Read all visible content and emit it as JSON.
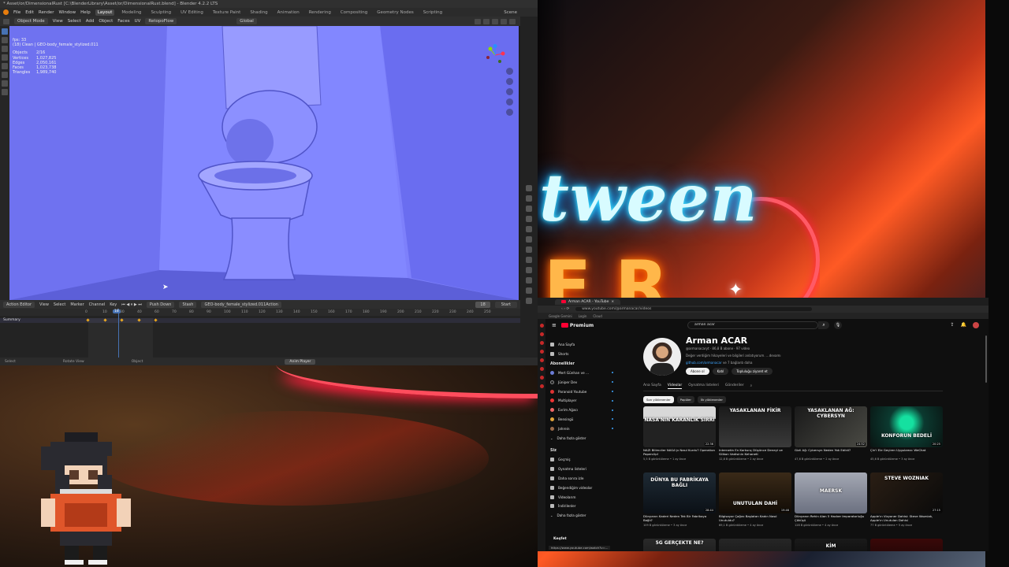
{
  "blender": {
    "title": "* Asset/or/DimensionalRust [C:\\BlenderLibrary\\Asset/or/DimensionalRust.blend] - Blender 4.2.2 LTS",
    "menu": [
      "File",
      "Edit",
      "Render",
      "Window",
      "Help"
    ],
    "workspaces": [
      "Layout",
      "Modeling",
      "Sculpting",
      "UV Editing",
      "Texture Paint",
      "Shading",
      "Animation",
      "Rendering",
      "Compositing",
      "Geometry Nodes",
      "Scripting"
    ],
    "active_workspace": "Layout",
    "scene": "Scene",
    "header": {
      "mode": "Object Mode",
      "items": [
        "View",
        "Select",
        "Add",
        "Object",
        "Faces",
        "UV"
      ],
      "retopoflow": "RetopoFlow",
      "transform": "Global",
      "options": "Options"
    },
    "stats": {
      "fps": "fps: 33",
      "object_name": "(18) Clean | GEO-body_female_stylized.011",
      "rows": [
        {
          "k": "Objects",
          "v": "2/16"
        },
        {
          "k": "Vertices",
          "v": "1,027,825"
        },
        {
          "k": "Edges",
          "v": "2,050,161"
        },
        {
          "k": "Faces",
          "v": "1,023,738"
        },
        {
          "k": "Triangles",
          "v": "1,989,740"
        }
      ]
    },
    "timeline": {
      "editor": "Action Editor",
      "menus": [
        "View",
        "Select",
        "Marker",
        "Channel",
        "Key"
      ],
      "push_down": "Push Down",
      "stash": "Stash",
      "action": "GEO-body_female_stylized.011Action",
      "frame": "18",
      "start": "Start",
      "summary": "Summary",
      "current_frame": "18",
      "ticks": [
        "0",
        "10",
        "30",
        "40",
        "60",
        "70",
        "80",
        "90",
        "100",
        "110",
        "120",
        "130",
        "140",
        "150",
        "160",
        "170",
        "180",
        "190",
        "200",
        "210",
        "220",
        "230",
        "240",
        "250"
      ],
      "keyframes": [
        0,
        10,
        20,
        30,
        40
      ]
    },
    "status": {
      "select": "Select",
      "rotate": "Rotate View",
      "object": "Object",
      "anim_player": "Anim Player"
    }
  },
  "overlay_art": {
    "neon_word": "tween",
    "neon_letters": "ER"
  },
  "youtube": {
    "tab_title": "Arman ACAR - YouTube",
    "url": "www.youtube.com/@armanacar/videos",
    "bookmarks": [
      "Google Gemini",
      "Login",
      "Cloud"
    ],
    "search_query": "arman acar",
    "premium_label": "Premium",
    "sidebar": {
      "top": [
        {
          "label": "Ana Sayfa",
          "icon": "home-icon"
        },
        {
          "label": "Shorts",
          "icon": "shorts-icon"
        }
      ],
      "subs_header": "Abonelikler",
      "subs": [
        {
          "label": "Mert Günhan ve ...",
          "live": true
        },
        {
          "label": "Jüniper Dev",
          "live": true
        },
        {
          "label": "Paranoid Youtube",
          "live": true
        },
        {
          "label": "Multiplayer",
          "live": true
        },
        {
          "label": "Evrim Ağacı",
          "live": true
        },
        {
          "label": "Bensingü",
          "live": true
        },
        {
          "label": "Jahrein",
          "live": true
        },
        {
          "label": "Daha fazla göster",
          "live": false
        }
      ],
      "you_header": "Siz",
      "you": [
        {
          "label": "Geçmiş",
          "icon": "history-icon"
        },
        {
          "label": "Oynatma listeleri",
          "icon": "playlist-icon"
        },
        {
          "label": "Daha sonra izle",
          "icon": "clock-icon"
        },
        {
          "label": "Beğendiğim videolar",
          "icon": "like-icon"
        },
        {
          "label": "Videolarım",
          "icon": "video-icon"
        },
        {
          "label": "İndirilenler",
          "icon": "download-icon"
        },
        {
          "label": "Daha fazla göster",
          "icon": "chevron-down-icon"
        }
      ],
      "explore": "Keşfet"
    },
    "channel": {
      "name": "Arman ACAR",
      "meta": "@armanacaryt · 86,8 B abone · 97 video",
      "desc": "Değer verdiğim hikayeleri ve bilgileri anlatıyorum. ...devamı",
      "link": "github.com/armanacar",
      "link_suffix": "ve 7 bağlantı daha",
      "buttons": [
        "Abone ol",
        "Katıl",
        "Topluluğu ziyaret et"
      ]
    },
    "tabs": [
      "Ana Sayfa",
      "Videolar",
      "Oynatma listeleri",
      "Gönderiler"
    ],
    "active_tab": "Videolar",
    "chips": [
      "Son yüklenenler",
      "Popüler",
      "İlk yüklenenler"
    ],
    "videos": [
      {
        "caption": "NASA'NIN KARANLIK SIRRI",
        "title": "NAZİ Bilimciler NASA'yı Nasıl Kurdu? Operation Paperclip!",
        "meta": "5,5 B görüntüleme • 1 ay önce",
        "duration": "22:36"
      },
      {
        "caption": "YASAKLANAN FİKİR",
        "title": "İnternetin En Korkunç Düşünce Deneyi ve Silikon Vadisinin Kehaneti",
        "meta": "12,8 B görüntüleme • 2 ay önce",
        "duration": ""
      },
      {
        "caption": "YASAKLANAN AĞ: CYBERSYN",
        "title": "Gizli Ağ: Cybersyn Neden Yok Edildi?",
        "meta": "47,6 B görüntüleme • 2 ay önce",
        "duration": "24:52"
      },
      {
        "caption": "KONFORUN BEDELİ",
        "title": "Çin'i Ele Geçiren Uygulama: WeChat",
        "meta": "45,6 B görüntüleme • 3 ay önce",
        "duration": "20:25"
      },
      {
        "caption": "DÜNYA BU FABRİKAYA BAĞLI",
        "title": "Dünyanın Kaderi Neden Tek Bir Fabrikaya Bağlı?",
        "meta": "109 B görüntüleme • 3 ay önce",
        "duration": "28:44"
      },
      {
        "caption": "UNUTULAN DAHİ",
        "title": "Bilgisayar Çağını Başlatan Kadın Nasıl Unutuldu?",
        "meta": "69,1 B görüntüleme • 4 ay önce",
        "duration": "19:46"
      },
      {
        "caption": "MAERSK",
        "title": "Dünyanın Rehin Alan 5 Hacker İmparatorluğu Çöküşü",
        "meta": "128 B görüntüleme • 4 ay önce",
        "duration": ""
      },
      {
        "caption": "STEVE WOZNIAK",
        "title": "Apple'ın Vizyoner Dahisi: Steve Wozniak, Apple'ın Unutulan Dahisi",
        "meta": "77 B görüntüleme • 5 ay önce",
        "duration": "27:15"
      },
      {
        "caption": "5G GERÇEKTE NE?",
        "title": "",
        "meta": "",
        "duration": ""
      },
      {
        "caption": "",
        "title": "",
        "meta": "",
        "duration": ""
      },
      {
        "caption": "KİM",
        "title": "",
        "meta": "",
        "duration": ""
      },
      {
        "caption": "",
        "title": "",
        "meta": "",
        "duration": ""
      }
    ],
    "status_url": "https://www.youtube.com/watch?v=..."
  }
}
